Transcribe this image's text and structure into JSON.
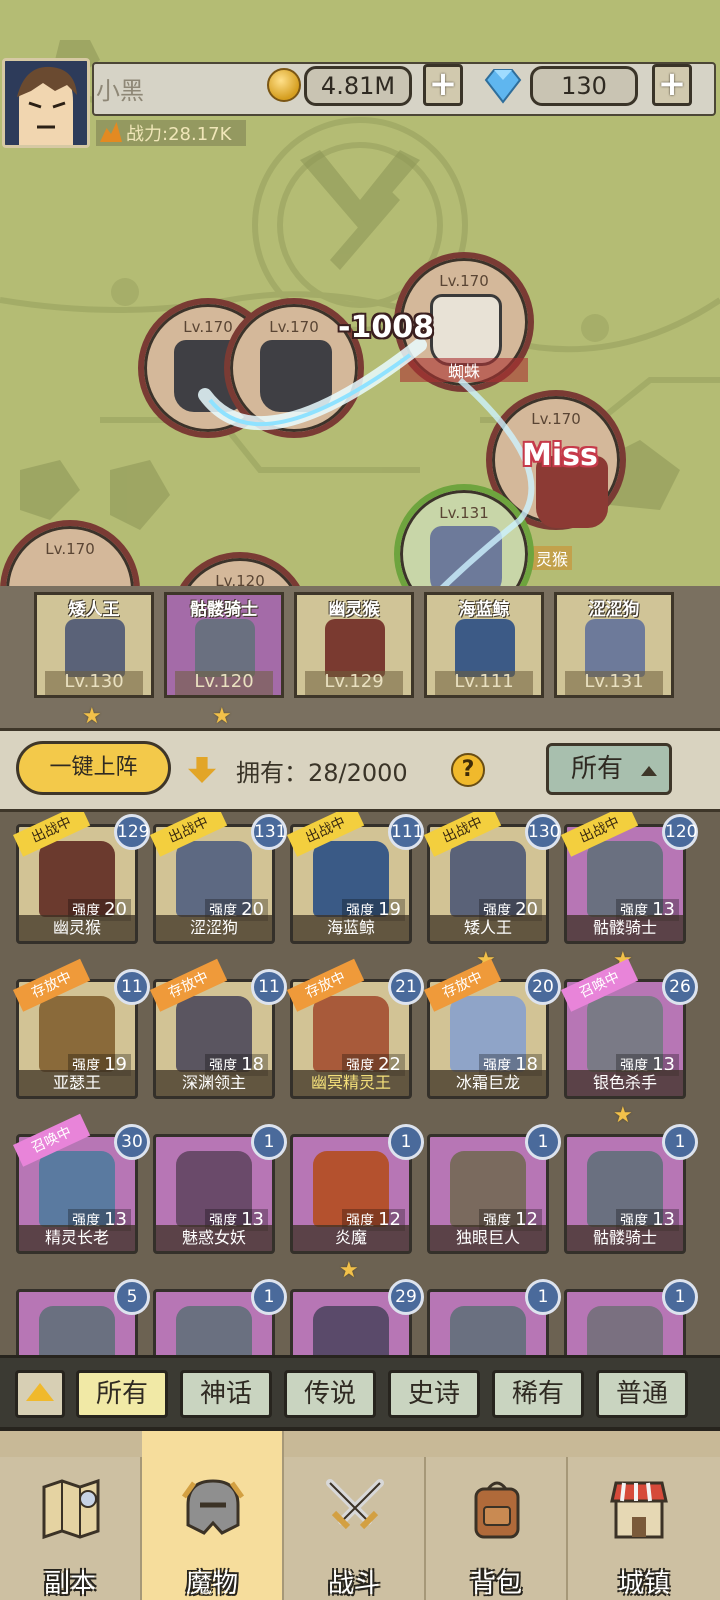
{
  "header": {
    "player_name": "小黑",
    "power_text": "战力:28.17K",
    "gold": "4.81M",
    "diamonds": "130",
    "plus_label": "+"
  },
  "battle": {
    "tokens": [
      {
        "level": "Lv.170",
        "name": ""
      },
      {
        "level": "Lv.170",
        "name": ""
      },
      {
        "level": "Lv.170",
        "name": "蜘蛛"
      },
      {
        "level": "Lv.170",
        "name": "灵猴"
      },
      {
        "level": "Lv.131",
        "name": ""
      },
      {
        "level": "Lv.170",
        "name": ""
      },
      {
        "level": "Lv.120",
        "name": ""
      }
    ],
    "damage": "-1008",
    "miss": "Miss"
  },
  "lineup": [
    {
      "name": "矮人王",
      "level": "Lv.130",
      "star": true,
      "color": "#d0c497"
    },
    {
      "name": "骷髅骑士",
      "level": "Lv.120",
      "star": true,
      "color": "#a46ba8"
    },
    {
      "name": "幽灵猴",
      "level": "Lv.129",
      "star": false,
      "color": "#d0c497"
    },
    {
      "name": "海蓝鲸",
      "level": "Lv.111",
      "star": false,
      "color": "#d0c497"
    },
    {
      "name": "涩涩狗",
      "level": "Lv.131",
      "star": false,
      "color": "#d0c497"
    }
  ],
  "controls": {
    "deploy_label": "一键上阵",
    "owned_text": "拥有：28/2000",
    "help_label": "?",
    "filter_label": "所有"
  },
  "monsters": [
    {
      "name": "幽灵猴",
      "strength_label": "强度",
      "strength": "20",
      "level": "129",
      "status": "出战中",
      "rarity": "legend",
      "star": false
    },
    {
      "name": "涩涩狗",
      "strength_label": "强度",
      "strength": "20",
      "level": "131",
      "status": "出战中",
      "rarity": "legend",
      "star": false
    },
    {
      "name": "海蓝鲸",
      "strength_label": "强度",
      "strength": "19",
      "level": "111",
      "status": "出战中",
      "rarity": "legend",
      "star": false
    },
    {
      "name": "矮人王",
      "strength_label": "强度",
      "strength": "20",
      "level": "130",
      "status": "出战中",
      "rarity": "legend",
      "star": true
    },
    {
      "name": "骷髅骑士",
      "strength_label": "强度",
      "strength": "13",
      "level": "120",
      "status": "出战中",
      "rarity": "epic",
      "star": true
    },
    {
      "name": "亚瑟王",
      "strength_label": "强度",
      "strength": "19",
      "level": "11",
      "status": "存放中",
      "rarity": "legend",
      "star": false
    },
    {
      "name": "深渊领主",
      "strength_label": "强度",
      "strength": "18",
      "level": "11",
      "status": "存放中",
      "rarity": "legend",
      "star": false
    },
    {
      "name": "幽冥精灵王",
      "strength_label": "强度",
      "strength": "22",
      "level": "21",
      "status": "存放中",
      "rarity": "legend",
      "star": false,
      "gold_name": true
    },
    {
      "name": "冰霜巨龙",
      "strength_label": "强度",
      "strength": "18",
      "level": "20",
      "status": "存放中",
      "rarity": "legend",
      "star": false
    },
    {
      "name": "银色杀手",
      "strength_label": "强度",
      "strength": "13",
      "level": "26",
      "status": "召唤中",
      "rarity": "epic",
      "star": true
    },
    {
      "name": "精灵长老",
      "strength_label": "强度",
      "strength": "13",
      "level": "30",
      "status": "召唤中",
      "rarity": "epic",
      "star": false
    },
    {
      "name": "魅惑女妖",
      "strength_label": "强度",
      "strength": "13",
      "level": "1",
      "status": "",
      "rarity": "epic",
      "star": false
    },
    {
      "name": "炎魔",
      "strength_label": "强度",
      "strength": "12",
      "level": "1",
      "status": "",
      "rarity": "epic",
      "star": true
    },
    {
      "name": "独眼巨人",
      "strength_label": "强度",
      "strength": "12",
      "level": "1",
      "status": "",
      "rarity": "epic",
      "star": false
    },
    {
      "name": "骷髅骑士",
      "strength_label": "强度",
      "strength": "13",
      "level": "1",
      "status": "",
      "rarity": "epic",
      "star": false
    },
    {
      "name": "",
      "strength_label": "",
      "strength": "",
      "level": "5",
      "status": "",
      "rarity": "epic",
      "star": false
    },
    {
      "name": "",
      "strength_label": "",
      "strength": "",
      "level": "1",
      "status": "",
      "rarity": "epic",
      "star": false
    },
    {
      "name": "",
      "strength_label": "",
      "strength": "",
      "level": "29",
      "status": "",
      "rarity": "epic",
      "star": false
    },
    {
      "name": "",
      "strength_label": "",
      "strength": "",
      "level": "1",
      "status": "",
      "rarity": "epic",
      "star": false
    },
    {
      "name": "",
      "strength_label": "",
      "strength": "",
      "level": "1",
      "status": "",
      "rarity": "epic",
      "star": false
    }
  ],
  "rarity_filter": {
    "options": [
      "所有",
      "神话",
      "传说",
      "史诗",
      "稀有",
      "普通"
    ],
    "selected": "所有"
  },
  "nav": {
    "items": [
      "副本",
      "魔物",
      "战斗",
      "背包",
      "城镇"
    ],
    "active": "魔物"
  },
  "colors": {
    "legend_card": "#d2c395",
    "epic_card": "#b776b5",
    "badge": "#4a6a9b",
    "accent": "#f3c94a"
  }
}
